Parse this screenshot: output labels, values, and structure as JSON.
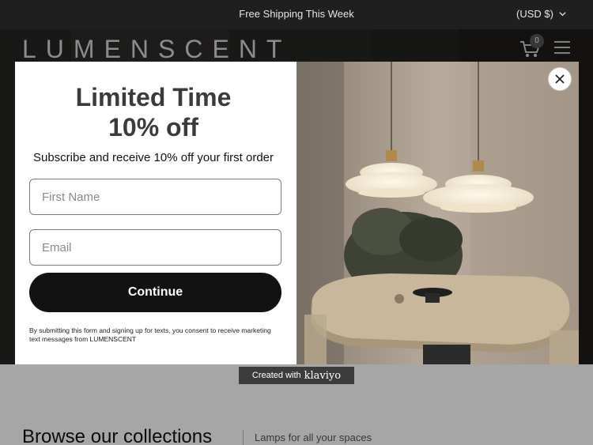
{
  "announcement": {
    "message": "Free Shipping This Week",
    "currency": "(USD $)"
  },
  "header": {
    "logo": "LUMENSCENT",
    "cart_count": "0"
  },
  "popup": {
    "headline_line1": "Limited Time",
    "headline_line2": "10% off",
    "subtext": "Subscribe and receive 10% off your first order",
    "first_name_placeholder": "First Name",
    "email_placeholder": "Email",
    "continue_label": "Continue",
    "legal": "By submitting this form and signing up for texts, you consent to receive marketing text messages from LUMENSCENT"
  },
  "badge": {
    "created_with": "Created with",
    "brand": "klaviyo"
  },
  "collections": {
    "title": "Browse our collections",
    "subtitle": "Lamps for all your spaces"
  },
  "colors": {
    "announcement_bg": "#1f1f1f",
    "button_bg": "#121212",
    "headline": "#3b3b3b"
  }
}
